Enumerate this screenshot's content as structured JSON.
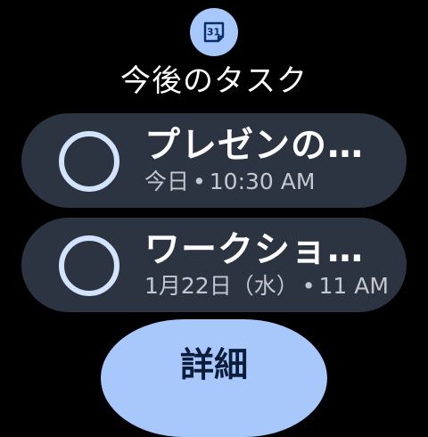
{
  "header": {
    "app_icon": "calendar-icon",
    "icon_date": "31",
    "title": "今後のタスク"
  },
  "tasks": [
    {
      "checkbox_icon": "circle-outline-icon",
      "title": "プレゼンの…",
      "date": "今日",
      "separator": "•",
      "time": "10:30 AM"
    },
    {
      "checkbox_icon": "circle-outline-icon",
      "title": "ワークショ…",
      "date": "1月22日（水）",
      "separator": "•",
      "time": "11 AM"
    }
  ],
  "actions": {
    "details_label": "詳細"
  },
  "colors": {
    "background": "#000000",
    "card": "#2d3441",
    "accent": "#a8c7fa",
    "checkbox_ring": "#d3e3fd"
  }
}
